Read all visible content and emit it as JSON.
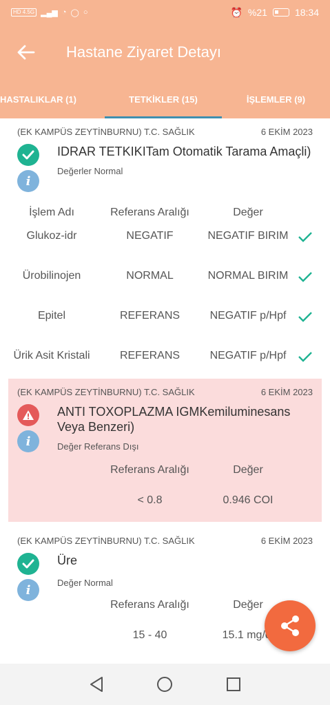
{
  "status_bar": {
    "network": "HD 4.5G",
    "battery": "%21",
    "time": "18:34"
  },
  "header": {
    "title": "Hastane Ziyaret Detayı"
  },
  "tabs": [
    {
      "label": "HASTALIKLAR (1)"
    },
    {
      "label": "TETKİKLER (15)",
      "active": true
    },
    {
      "label": "İŞLEMLER (9)"
    }
  ],
  "cards": [
    {
      "hospital": "(EK KAMPÜS ZEYTİNBURNU) T.C. SAĞLIK",
      "date": "6 EKİM 2023",
      "title": "IDRAR TETKIKITam Otomatik Tarama Amaçli)",
      "status": "Değerler Normal",
      "headers": [
        "İşlem Adı",
        "Referans Aralığı",
        "Değer"
      ],
      "rows": [
        {
          "name": "Glukoz-idr",
          "ref": "NEGATIF",
          "value": "NEGATIF BIRIM"
        },
        {
          "name": "Ürobilinojen",
          "ref": "NORMAL",
          "value": "NORMAL BIRIM"
        },
        {
          "name": "Epitel",
          "ref": "REFERANS",
          "value": "NEGATIF p/Hpf"
        },
        {
          "name": "Ürik Asit Kristali",
          "ref": "REFERANS",
          "value": "NEGATIF p/Hpf"
        }
      ]
    },
    {
      "hospital": "(EK KAMPÜS ZEYTİNBURNU) T.C. SAĞLIK",
      "date": "6 EKİM 2023",
      "title": "ANTI TOXOPLAZMA IGMKemiluminesans Veya Benzeri)",
      "status": "Değer Referans Dışı",
      "headers": [
        "Referans Aralığı",
        "Değer"
      ],
      "row": {
        "ref": "< 0.8",
        "value": "0.946 COI"
      }
    },
    {
      "hospital": "(EK KAMPÜS ZEYTİNBURNU) T.C. SAĞLIK",
      "date": "6 EKİM 2023",
      "title": "Üre",
      "status": "Değer Normal",
      "headers": [
        "Referans Aralığı",
        "Değer"
      ],
      "row": {
        "ref": "15 - 40",
        "value": "15.1 mg/dl"
      }
    }
  ],
  "colors": {
    "accent": "#f7b592",
    "ok": "#1fb392",
    "warn": "#e45a5a",
    "info": "#7fb3dc",
    "fab": "#f26a3f",
    "alert_bg": "#fbdcdc"
  },
  "icons": {
    "back": "arrow-left-icon",
    "share": "share-icon",
    "ok": "check-circle-icon",
    "warn": "warning-icon",
    "info": "info-icon"
  }
}
